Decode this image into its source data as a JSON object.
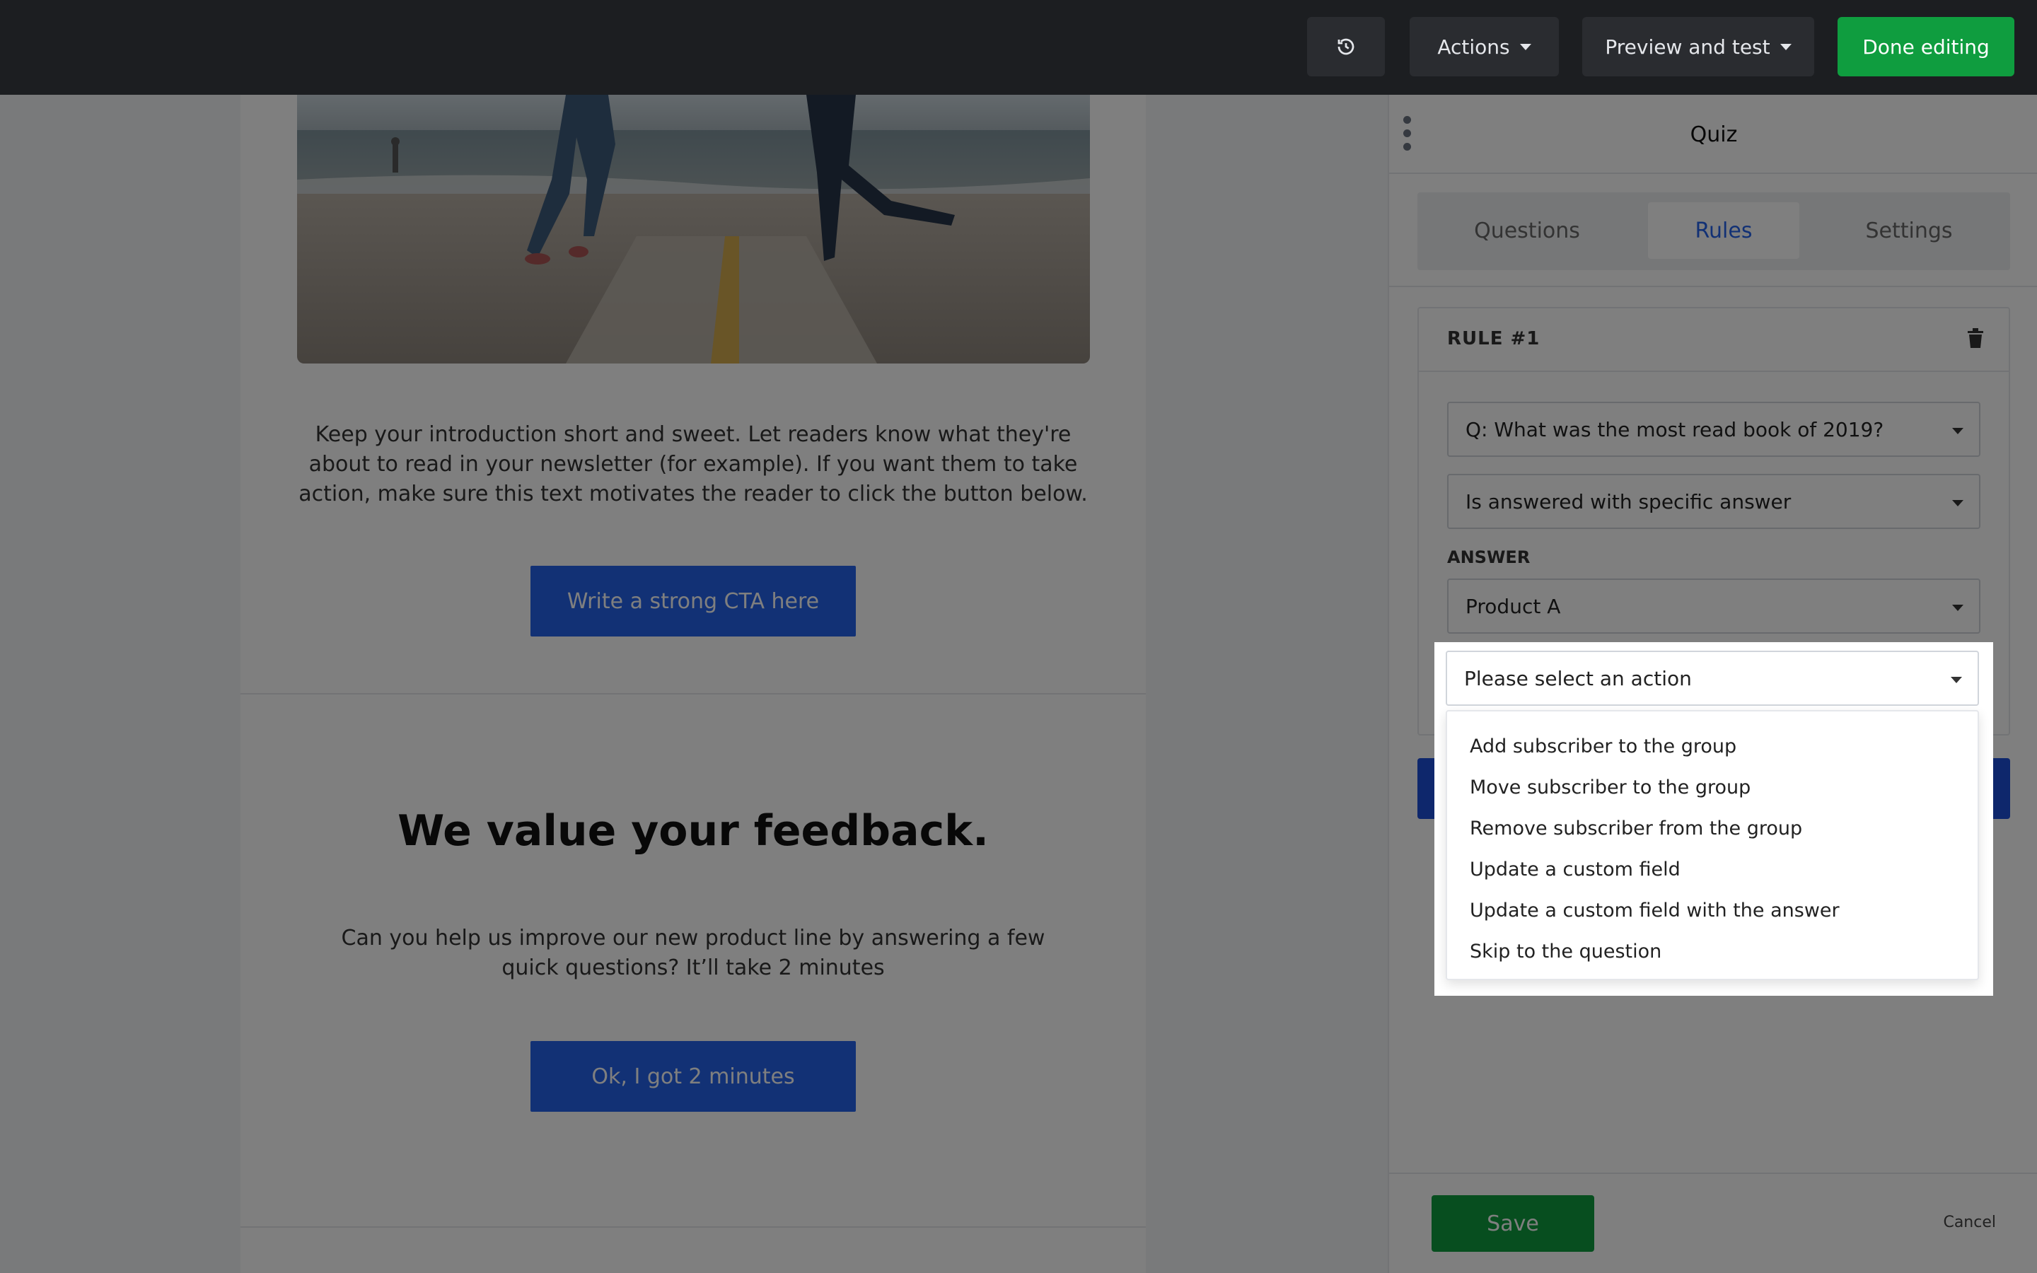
{
  "topbar": {
    "history_icon": "history-icon",
    "actions_label": "Actions",
    "preview_label": "Preview and test",
    "done_label": "Done editing",
    "done_color": "#0f9d3f"
  },
  "email": {
    "intro_text": "Keep your introduction short and sweet. Let readers know what they're about to read in your newsletter (for example). If you want them to take action, make sure this text motivates the reader to click the button below.",
    "cta1_label": "Write a strong CTA here",
    "feedback_title": "We value your feedback.",
    "feedback_text": "Can you help us improve our new product line by answering a few quick questions? It’ll take 2 minutes",
    "cta2_label": "Ok, I got 2 minutes",
    "cta_color": "#2563eb"
  },
  "panel": {
    "title": "Quiz",
    "tabs": [
      {
        "label": "Questions",
        "active": false
      },
      {
        "label": "Rules",
        "active": true
      },
      {
        "label": "Settings",
        "active": false
      }
    ],
    "rule": {
      "title": "RULE #1",
      "question_select": "Q: What was the most read book of 2019?",
      "condition_select": "Is answered with specific answer",
      "answer_label": "ANSWER",
      "answer_select": "Product A",
      "action_select": "Please select an action"
    },
    "action_options": [
      "Add subscriber to the group",
      "Move subscriber to the group",
      "Remove subscriber from the group",
      "Update a custom field",
      "Update a custom field with the answer",
      "Skip to the question"
    ],
    "save_label": "Save",
    "cancel_label": "Cancel"
  }
}
